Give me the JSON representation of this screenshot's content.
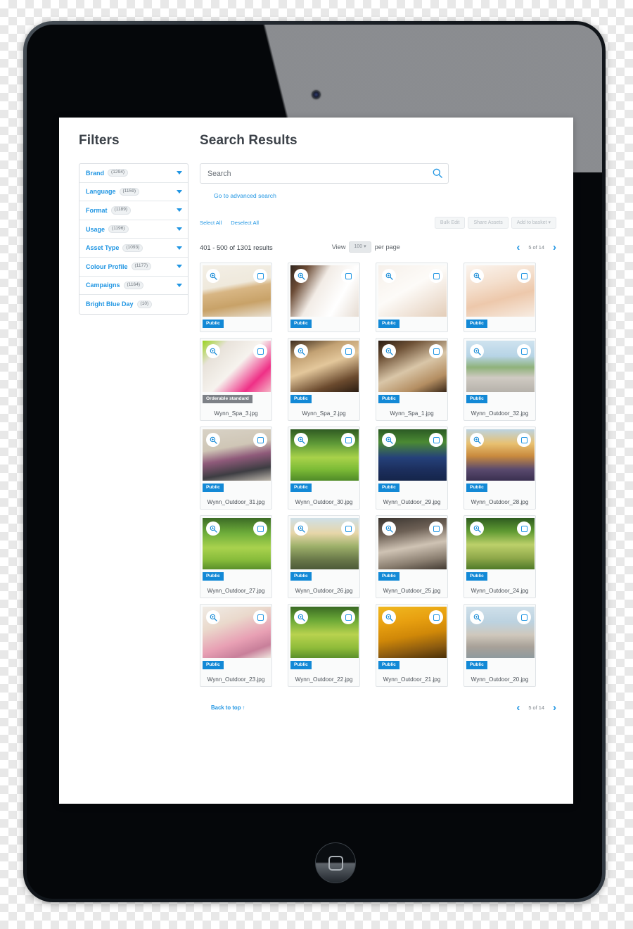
{
  "sidebar": {
    "title": "Filters",
    "filters": [
      {
        "label": "Brand",
        "count": "(1294)",
        "expandable": true
      },
      {
        "label": "Language",
        "count": "(1159)",
        "expandable": true
      },
      {
        "label": "Format",
        "count": "(1189)",
        "expandable": true
      },
      {
        "label": "Usage",
        "count": "(1196)",
        "expandable": true
      },
      {
        "label": "Asset Type",
        "count": "(1093)",
        "expandable": true
      },
      {
        "label": "Colour Profile",
        "count": "(1177)",
        "expandable": true
      },
      {
        "label": "Campaigns",
        "count": "(1164)",
        "expandable": true
      },
      {
        "label": "Bright Blue Day",
        "count": "(10)",
        "expandable": false
      }
    ]
  },
  "main": {
    "title": "Search Results",
    "search": {
      "placeholder": "Search",
      "value": "",
      "advanced_link": "Go to advanced search",
      "icon": "search-icon"
    },
    "select_all": "Select All",
    "deselect_all": "Deselect All",
    "bulk_actions": [
      {
        "label": "Bulk Edit"
      },
      {
        "label": "Share Assets"
      },
      {
        "label": "Add to basket ▾"
      }
    ],
    "results_count": "401 - 500 of 1301 results",
    "view_prefix": "View",
    "per_page_value": "100 ▾",
    "view_suffix": "per page",
    "pager": {
      "prev": "‹",
      "next": "›",
      "label": "5 of 14"
    },
    "back_to_top": "Back to top ↑"
  },
  "colors": {
    "accent": "#2196e3",
    "badge_public": "#1389d6",
    "badge_orderable": "#7d8187",
    "text": "#4b5158",
    "muted": "#b3b9bf"
  },
  "grid": {
    "items": [
      {
        "name": "",
        "badge": "Public",
        "badge_type": "public",
        "show_name": false,
        "art": "spa-reception"
      },
      {
        "name": "",
        "badge": "Public",
        "badge_type": "public",
        "show_name": false,
        "art": "spa-women-masks"
      },
      {
        "name": "",
        "badge": "Public",
        "badge_type": "public",
        "show_name": false,
        "art": "spa-robe-relax"
      },
      {
        "name": "",
        "badge": "Public",
        "badge_type": "public",
        "show_name": false,
        "art": "spa-three-women"
      },
      {
        "name": "Wynn_Spa_3.jpg",
        "badge": "Orderable standard",
        "badge_type": "orderable",
        "show_name": true,
        "art": "spa-circle-masks"
      },
      {
        "name": "Wynn_Spa_2.jpg",
        "badge": "Public",
        "badge_type": "public",
        "show_name": true,
        "art": "spa-pool-room"
      },
      {
        "name": "Wynn_Spa_1.jpg",
        "badge": "Public",
        "badge_type": "public",
        "show_name": true,
        "art": "spa-loungers"
      },
      {
        "name": "Wynn_Outdoor_32.jpg",
        "badge": "Public",
        "badge_type": "public",
        "show_name": true,
        "art": "outdoor-runner-crouch"
      },
      {
        "name": "Wynn_Outdoor_31.jpg",
        "badge": "Public",
        "badge_type": "public",
        "show_name": true,
        "art": "outdoor-shoe-tie"
      },
      {
        "name": "Wynn_Outdoor_30.jpg",
        "badge": "Public",
        "badge_type": "public",
        "show_name": true,
        "art": "outdoor-park-class"
      },
      {
        "name": "Wynn_Outdoor_29.jpg",
        "badge": "Public",
        "badge_type": "public",
        "show_name": true,
        "art": "outdoor-crowd-arms"
      },
      {
        "name": "Wynn_Outdoor_28.jpg",
        "badge": "Public",
        "badge_type": "public",
        "show_name": true,
        "art": "outdoor-crowd-sunset"
      },
      {
        "name": "Wynn_Outdoor_27.jpg",
        "badge": "Public",
        "badge_type": "public",
        "show_name": true,
        "art": "outdoor-group-grass"
      },
      {
        "name": "Wynn_Outdoor_26.jpg",
        "badge": "Public",
        "badge_type": "public",
        "show_name": true,
        "art": "outdoor-road-runners"
      },
      {
        "name": "Wynn_Outdoor_25.jpg",
        "badge": "Public",
        "badge_type": "public",
        "show_name": true,
        "art": "outdoor-mat-stretch"
      },
      {
        "name": "Wynn_Outdoor_24.jpg",
        "badge": "Public",
        "badge_type": "public",
        "show_name": true,
        "art": "outdoor-tree-path"
      },
      {
        "name": "Wynn_Outdoor_23.jpg",
        "badge": "Public",
        "badge_type": "public",
        "show_name": true,
        "art": "outdoor-yoga-pair"
      },
      {
        "name": "Wynn_Outdoor_22.jpg",
        "badge": "Public",
        "badge_type": "public",
        "show_name": true,
        "art": "outdoor-plank-row"
      },
      {
        "name": "Wynn_Outdoor_21.jpg",
        "badge": "Public",
        "badge_type": "public",
        "show_name": true,
        "art": "outdoor-autumn-shoe"
      },
      {
        "name": "Wynn_Outdoor_20.jpg",
        "badge": "Public",
        "badge_type": "public",
        "show_name": true,
        "art": "outdoor-pier-yoga"
      }
    ]
  }
}
